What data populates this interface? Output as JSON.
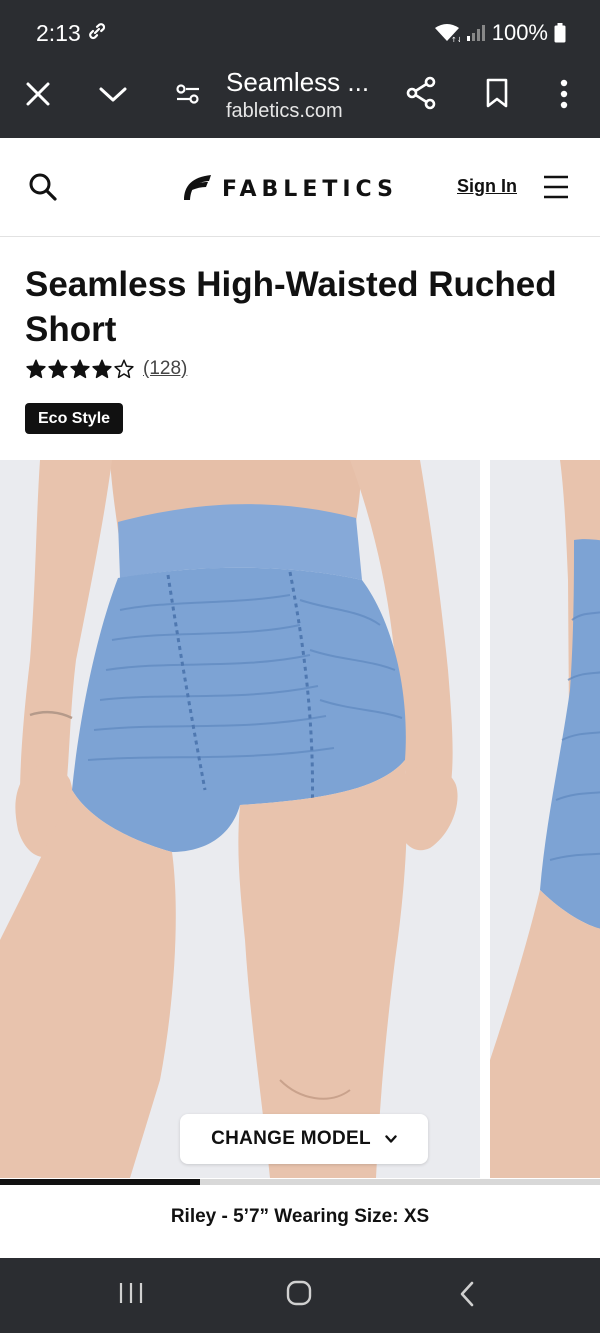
{
  "status_bar": {
    "time": "2:13",
    "battery": "100%",
    "icons": [
      "link-icon",
      "wifi-icon",
      "signal-icon",
      "battery-icon"
    ]
  },
  "browser": {
    "tab_title": "Seamless ...",
    "domain": "fabletics.com",
    "icons": [
      "close-icon",
      "chevron-down-icon",
      "site-settings-icon",
      "share-icon",
      "bookmark-icon",
      "more-vert-icon"
    ]
  },
  "site_header": {
    "logo_text": "FABLETICS",
    "sign_in_label": "Sign In",
    "icons": [
      "search-icon",
      "logo-mark-icon",
      "hamburger-menu-icon"
    ]
  },
  "product": {
    "title": "Seamless High-Waisted Ruched Short",
    "rating": 4,
    "rating_max": 5,
    "review_count": "(128)",
    "badge": "Eco Style"
  },
  "gallery": {
    "change_model_label": "CHANGE MODEL",
    "progress_fraction": 0.333,
    "model_info": "Riley - 5’7” Wearing Size: XS",
    "colors": {
      "shorts": "#7da3d4",
      "shorts_dark": "#6089bf",
      "skin": "#e9c2ac",
      "background": "#e9eaee"
    }
  },
  "nav_bar": {
    "icons": [
      "recents-icon",
      "home-icon",
      "back-icon"
    ]
  },
  "colors": {
    "chrome": "#2b2d31",
    "text": "#111111",
    "badge_bg": "#111111"
  }
}
